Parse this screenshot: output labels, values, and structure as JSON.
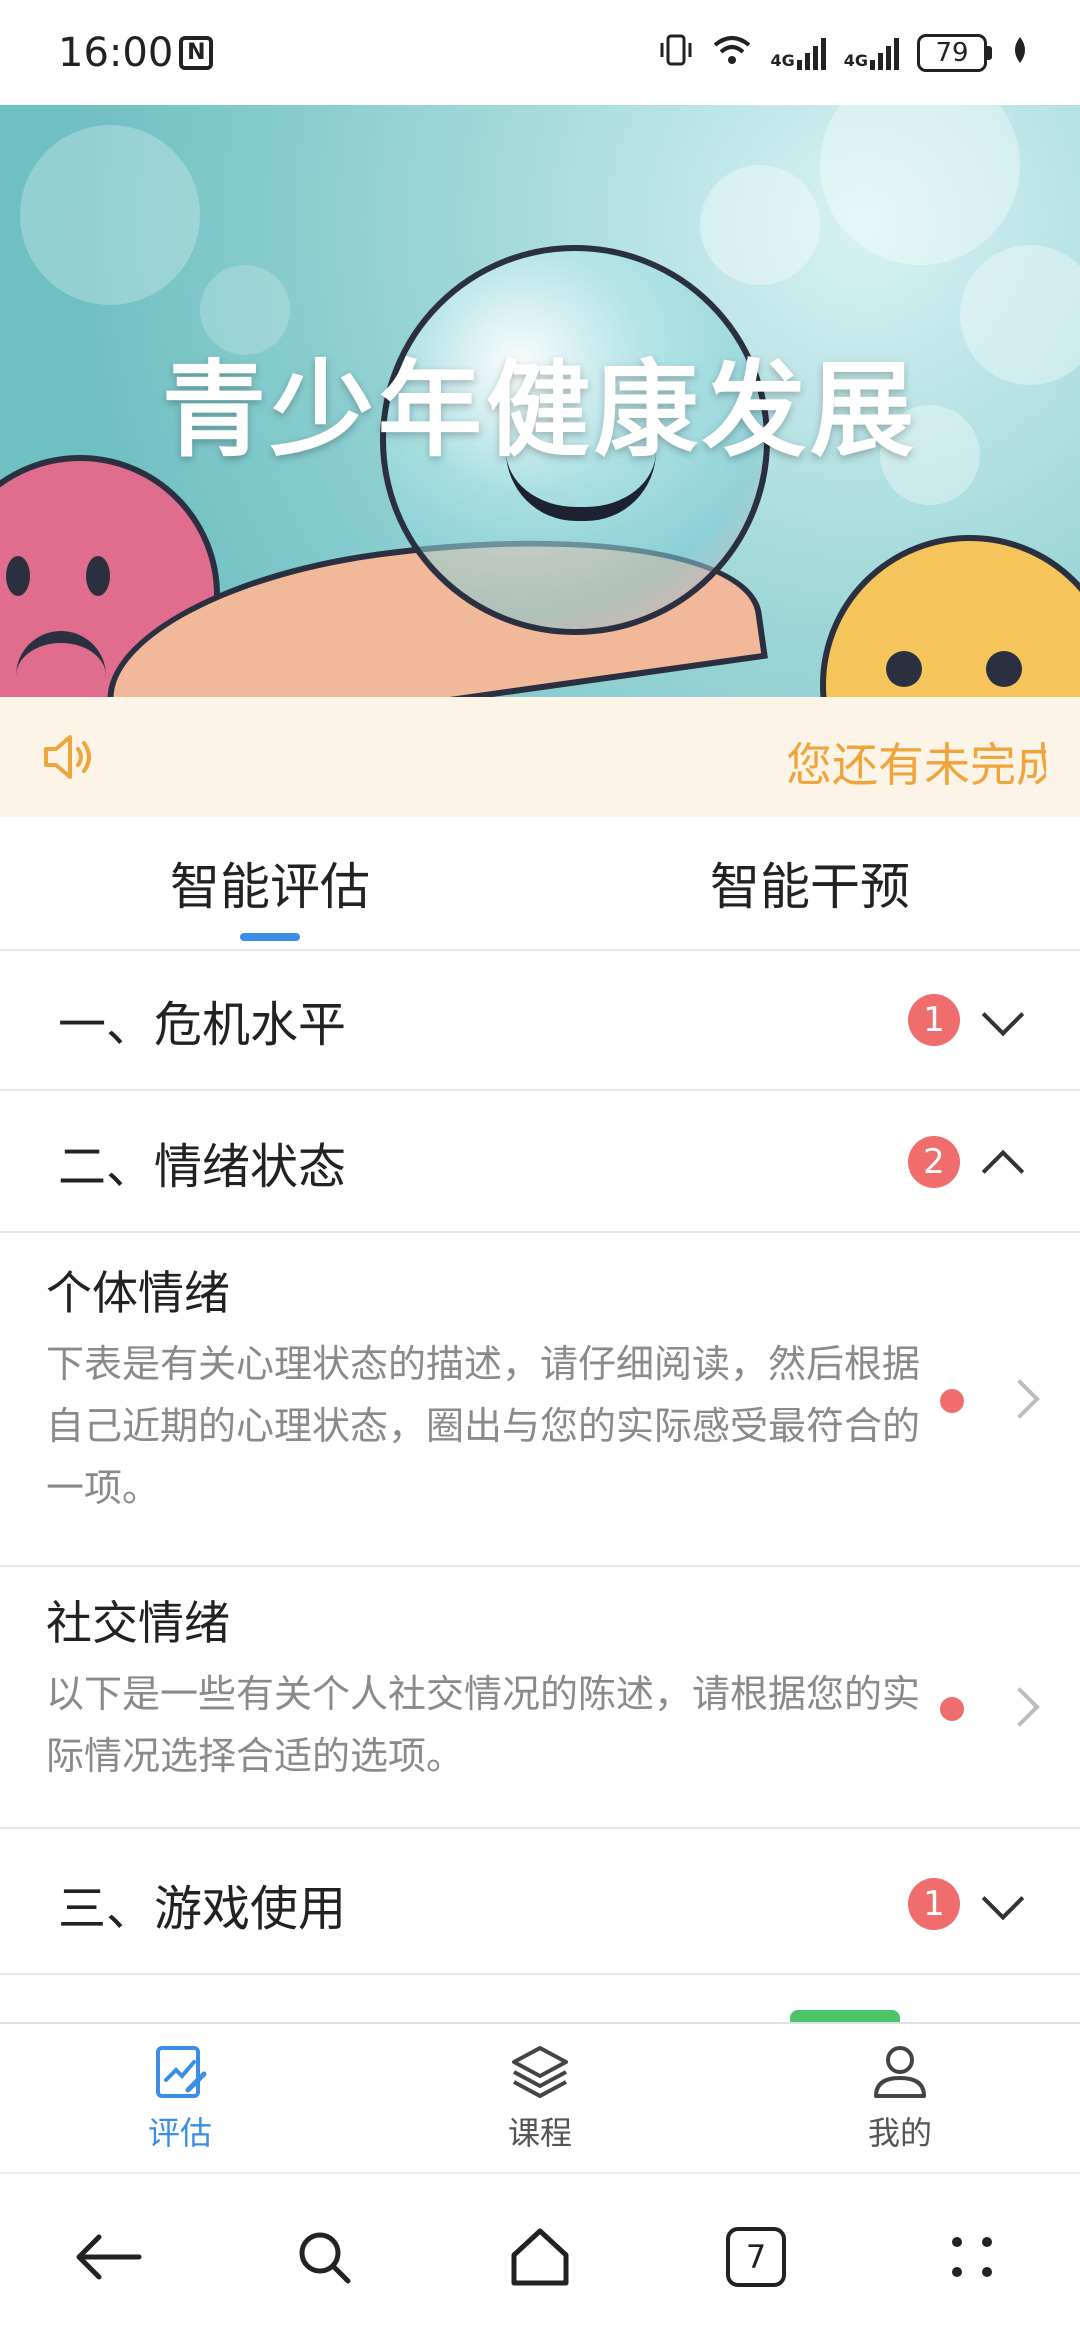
{
  "status_bar": {
    "time": "16:00",
    "network_1": "4G",
    "network_2": "4G",
    "battery": "79"
  },
  "banner": {
    "title": "青少年健康发展"
  },
  "notice": {
    "text": "您还有未完成"
  },
  "tabs": [
    {
      "label": "智能评估",
      "active": true
    },
    {
      "label": "智能干预",
      "active": false
    }
  ],
  "sections": [
    {
      "title": "一、危机水平",
      "badge": "1",
      "expanded": false
    },
    {
      "title": "二、情绪状态",
      "badge": "2",
      "expanded": true
    },
    {
      "title": "三、游戏使用",
      "badge": "1",
      "expanded": false
    }
  ],
  "items": [
    {
      "title": "个体情绪",
      "description": "下表是有关心理状态的描述，请仔细阅读，然后根据自己近期的心理状态，圈出与您的实际感受最符合的一项。"
    },
    {
      "title": "社交情绪",
      "description": "以下是一些有关个人社交情况的陈述，请根据您的实际情况选择合适的选项。"
    }
  ],
  "bottom_nav": [
    {
      "label": "评估",
      "icon": "assessment-icon",
      "active": true
    },
    {
      "label": "课程",
      "icon": "layers-icon",
      "active": false
    },
    {
      "label": "我的",
      "icon": "user-icon",
      "active": false
    }
  ],
  "system_nav": {
    "tab_count": "7"
  },
  "colors": {
    "accent": "#3a8ee6",
    "badge": "#f06d6d",
    "notice_bg": "#fdf4e8",
    "notice_text": "#f0a43c"
  }
}
